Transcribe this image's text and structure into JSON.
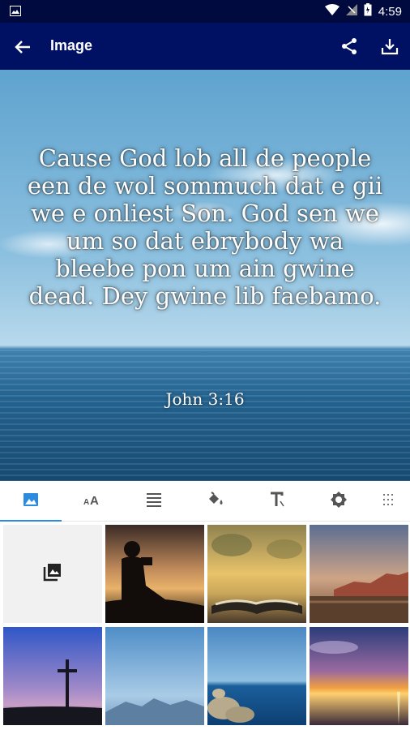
{
  "status_bar": {
    "time": "4:59"
  },
  "app_bar": {
    "title": "Image"
  },
  "verse": {
    "text": "Cause God lob all de people een de wol sommuch dat e gii we e onliest Son. God sen we um so dat ebrybody wa bleebe pon um ain gwine dead. Dey gwine lib faebamo.",
    "reference": "John 3:16"
  },
  "tool_tabs": [
    {
      "icon": "image-icon",
      "active": true
    },
    {
      "icon": "font-size-icon",
      "active": false
    },
    {
      "icon": "text-align-icon",
      "active": false
    },
    {
      "icon": "paint-bucket-icon",
      "active": false
    },
    {
      "icon": "text-format-icon",
      "active": false
    },
    {
      "icon": "brightness-icon",
      "active": false
    },
    {
      "icon": "texture-icon",
      "active": false
    }
  ],
  "backgrounds": [
    {
      "icon": "photo-library-icon",
      "description": "pick from gallery"
    },
    {
      "scene": "silhouette-reading-sunset"
    },
    {
      "scene": "open-bible-blurred"
    },
    {
      "scene": "desert-mountains"
    },
    {
      "scene": "cross-purple-sky"
    },
    {
      "scene": "misty-mountains"
    },
    {
      "scene": "lake-rocks-blue"
    },
    {
      "scene": "ocean-sunset"
    }
  ],
  "colors": {
    "app_bar": "#001063",
    "status_bar": "#000a3e",
    "accent": "#2a8be0"
  }
}
